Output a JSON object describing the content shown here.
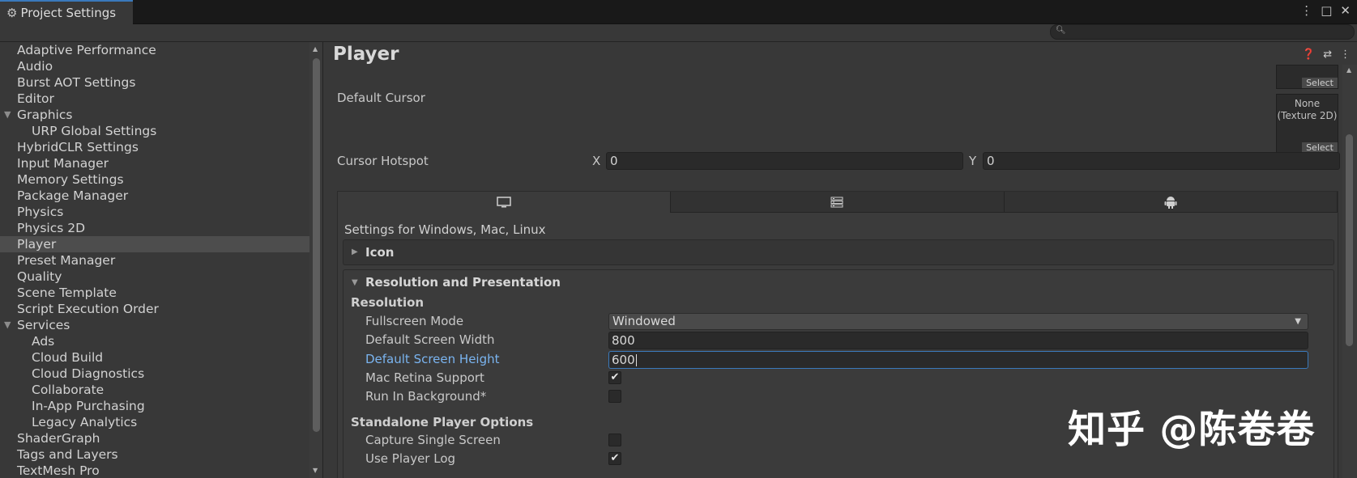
{
  "window": {
    "tab_title": "Project Settings",
    "controls": [
      "⋮",
      "□",
      "✕"
    ]
  },
  "search": {
    "placeholder": ""
  },
  "sidebar": {
    "items": [
      {
        "label": "Adaptive Performance",
        "level": 0
      },
      {
        "label": "Audio",
        "level": 0
      },
      {
        "label": "Burst AOT Settings",
        "level": 0
      },
      {
        "label": "Editor",
        "level": 0
      },
      {
        "label": "Graphics",
        "level": 0,
        "expanded": true
      },
      {
        "label": "URP Global Settings",
        "level": 1
      },
      {
        "label": "HybridCLR Settings",
        "level": 0
      },
      {
        "label": "Input Manager",
        "level": 0
      },
      {
        "label": "Memory Settings",
        "level": 0
      },
      {
        "label": "Package Manager",
        "level": 0
      },
      {
        "label": "Physics",
        "level": 0
      },
      {
        "label": "Physics 2D",
        "level": 0
      },
      {
        "label": "Player",
        "level": 0,
        "selected": true
      },
      {
        "label": "Preset Manager",
        "level": 0
      },
      {
        "label": "Quality",
        "level": 0
      },
      {
        "label": "Scene Template",
        "level": 0
      },
      {
        "label": "Script Execution Order",
        "level": 0
      },
      {
        "label": "Services",
        "level": 0,
        "expanded": true
      },
      {
        "label": "Ads",
        "level": 1
      },
      {
        "label": "Cloud Build",
        "level": 1
      },
      {
        "label": "Cloud Diagnostics",
        "level": 1
      },
      {
        "label": "Collaborate",
        "level": 1
      },
      {
        "label": "In-App Purchasing",
        "level": 1
      },
      {
        "label": "Legacy Analytics",
        "level": 1
      },
      {
        "label": "ShaderGraph",
        "level": 0
      },
      {
        "label": "Tags and Layers",
        "level": 0
      },
      {
        "label": "TextMesh Pro",
        "level": 0
      }
    ]
  },
  "main": {
    "title": "Player",
    "header_icons": [
      "help-icon",
      "preset-icon",
      "menu-icon"
    ],
    "select_label": "Select",
    "default_cursor_label": "Default Cursor",
    "default_cursor_value": "None",
    "default_cursor_type": "(Texture 2D)",
    "cursor_hotspot_label": "Cursor Hotspot",
    "hotspot_x_label": "X",
    "hotspot_x_value": "0",
    "hotspot_y_label": "Y",
    "hotspot_y_value": "0",
    "platform_tabs": [
      "desktop-icon",
      "server-icon",
      "android-icon"
    ],
    "settings_for": "Settings for Windows, Mac, Linux",
    "icon_section": "Icon",
    "resolution_section": "Resolution and Presentation",
    "resolution_header": "Resolution",
    "fullscreen_mode_label": "Fullscreen Mode",
    "fullscreen_mode_value": "Windowed",
    "default_width_label": "Default Screen Width",
    "default_width_value": "800",
    "default_height_label": "Default Screen Height",
    "default_height_value": "600",
    "mac_retina_label": "Mac Retina Support",
    "mac_retina_checked": true,
    "run_in_background_label": "Run In Background*",
    "run_in_background_checked": false,
    "standalone_header": "Standalone Player Options",
    "capture_single_screen_label": "Capture Single Screen",
    "capture_single_screen_checked": false,
    "use_player_log_label": "Use Player Log",
    "use_player_log_checked": true
  },
  "watermark": "知乎 @陈卷卷",
  "colors": {
    "background": "#383838",
    "titlebar": "#191919",
    "focus_blue": "#3a79bb",
    "focus_label": "#7ab4f0"
  }
}
